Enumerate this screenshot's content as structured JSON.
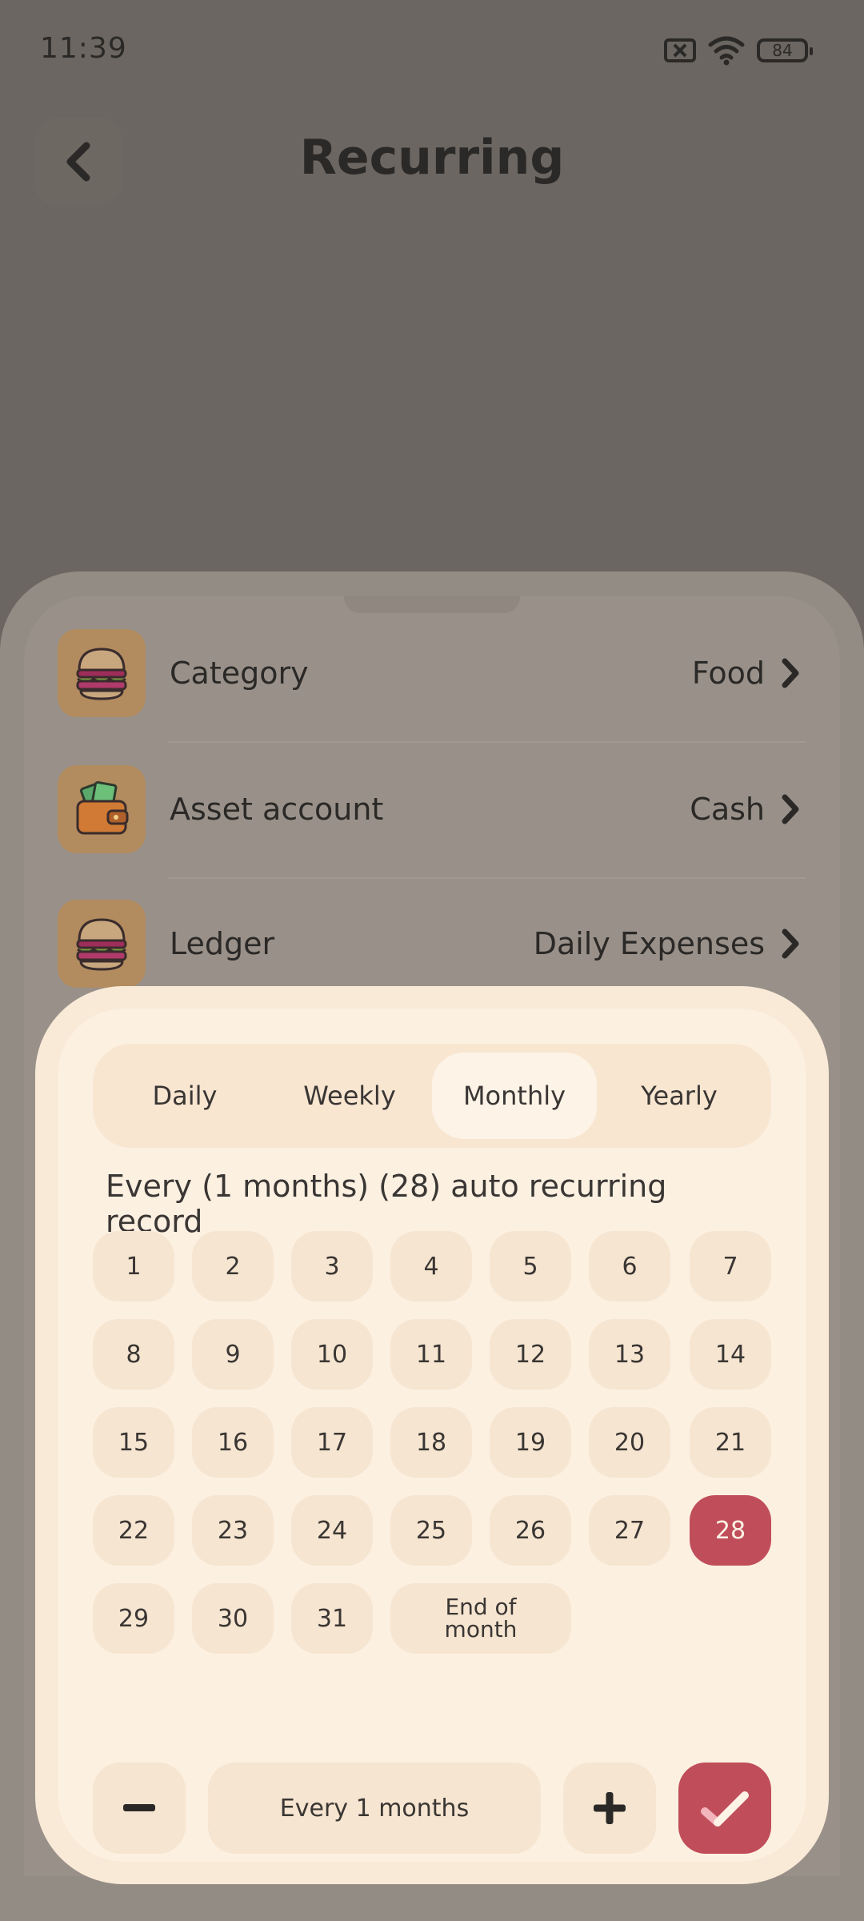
{
  "status_bar": {
    "time": "11:39",
    "battery": "84"
  },
  "header": {
    "title": "Recurring"
  },
  "settings": [
    {
      "label": "Category",
      "value": "Food",
      "icon": "burger-icon"
    },
    {
      "label": "Asset account",
      "value": "Cash",
      "icon": "wallet-icon"
    },
    {
      "label": "Ledger",
      "value": "Daily Expenses",
      "icon": "burger-icon"
    }
  ],
  "picker": {
    "tabs": [
      "Daily",
      "Weekly",
      "Monthly",
      "Yearly"
    ],
    "active_tab": "Monthly",
    "summary": "Every (1 months) (28) auto recurring record",
    "days": [
      "1",
      "2",
      "3",
      "4",
      "5",
      "6",
      "7",
      "8",
      "9",
      "10",
      "11",
      "12",
      "13",
      "14",
      "15",
      "16",
      "17",
      "18",
      "19",
      "20",
      "21",
      "22",
      "23",
      "24",
      "25",
      "26",
      "27",
      "28",
      "29",
      "30",
      "31"
    ],
    "end_of_month_line1": "End of",
    "end_of_month_line2": "month",
    "selected_day": "28",
    "interval_label": "Every 1 months"
  },
  "colors": {
    "accent": "#c04e5a",
    "sheet": "#fcf0e1",
    "chip": "#f6e5d0",
    "overlay": "#6b6661"
  }
}
